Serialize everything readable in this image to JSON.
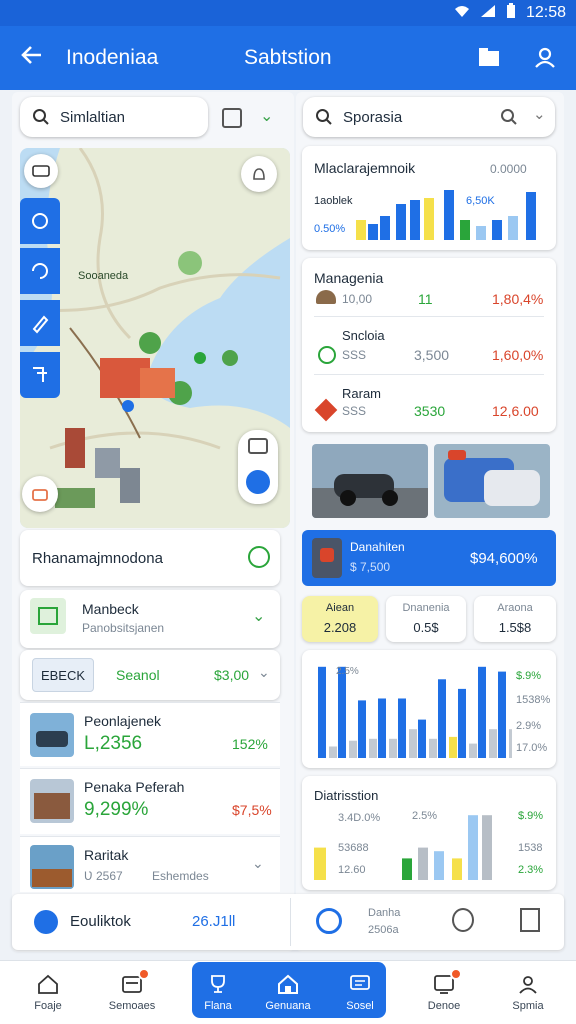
{
  "status": {
    "time": "12:58"
  },
  "appbar": {
    "title": "Inodeniaa",
    "center_title": "Sabtstion"
  },
  "left_search": {
    "placeholder": "Simlaltian"
  },
  "right_search": {
    "placeholder": "Sporasia"
  },
  "map": {
    "place_label": "Sooaneda"
  },
  "left_card": {
    "title": "Rhanamajmnodona"
  },
  "manbeck": {
    "title": "Manbeck",
    "subtitle": "Panobsitsjanen"
  },
  "ebeck": {
    "tag": "EBECK",
    "label": "Seanol",
    "value": "$3,00"
  },
  "list": [
    {
      "title": "Peonlajenek",
      "value": "L,2356",
      "pct": "152%"
    },
    {
      "title": "Penaka Peferah",
      "value": "9,299%",
      "pct": "$7,5%"
    },
    {
      "title": "Raritak",
      "value": "Ʋ 2567",
      "sub": "Eshemdes"
    }
  ],
  "footer_left": {
    "label": "Eouliktok",
    "value": "26.J1ll"
  },
  "footer_right": {
    "label": "Danha",
    "value": "2506a"
  },
  "chart1": {
    "title": "Mlaclarajemnoik",
    "value": "0.0000",
    "label_a": "1aoblek",
    "label_b": "0.50%",
    "label_c": "6,50K"
  },
  "mgmt": {
    "title": "Managenia",
    "items": [
      {
        "name": "",
        "a": "10,00",
        "b": "11",
        "c": "1,80,4%"
      },
      {
        "name": "Sncloia",
        "a": "SSS",
        "b": "3,500",
        "c": "1,60,0%"
      },
      {
        "name": "Raram",
        "a": "SSS",
        "b": "3530",
        "c": "12,6.00"
      }
    ]
  },
  "promo": {
    "title": "Danahiten",
    "sub": "$ 7,500",
    "value": "$94,600%"
  },
  "stats": [
    {
      "label": "Aiean",
      "value": "2.208"
    },
    {
      "label": "Dnanenia",
      "value": "0.5$"
    },
    {
      "label": "Araona",
      "value": "1.5$8"
    }
  ],
  "chart2": {
    "labels": [
      "2.5%",
      "$.9%",
      "1538%",
      "2.9%",
      "17.0%"
    ],
    "series": [
      {
        "name": "blue",
        "values": [
          95,
          95,
          60,
          62,
          62,
          40,
          82,
          72,
          95,
          90
        ]
      },
      {
        "name": "gray",
        "values": [
          12,
          18,
          20,
          20,
          30,
          20,
          15,
          15,
          30,
          30
        ]
      },
      {
        "name": "yellow",
        "values": [
          0,
          0,
          0,
          0,
          0,
          0,
          22,
          0,
          0,
          0
        ]
      }
    ]
  },
  "chart3": {
    "title": "Diatrisstion",
    "labels": [
      "3.4D.0%",
      "2.5%",
      "53688",
      "12.60",
      "$.9%",
      "1538",
      "2.3%"
    ],
    "values": [
      45,
      30,
      45,
      40,
      30,
      90,
      90
    ],
    "colors": [
      "#f5e04a",
      "#2aa53a",
      "#b7bec6",
      "#9bc8f2",
      "#f5e04a",
      "#9bc8f2",
      "#b7bec6"
    ]
  },
  "nav": [
    {
      "label": "Foaje"
    },
    {
      "label": "Semoaes"
    },
    {
      "label": "Flana"
    },
    {
      "label": "Genuana"
    },
    {
      "label": "Sosel"
    },
    {
      "label": "Denoe"
    },
    {
      "label": "Spmia"
    }
  ],
  "colors": {
    "primary": "#1f6fe5",
    "green": "#2aa53a",
    "red": "#d9452b",
    "yellow": "#f5e04a"
  }
}
